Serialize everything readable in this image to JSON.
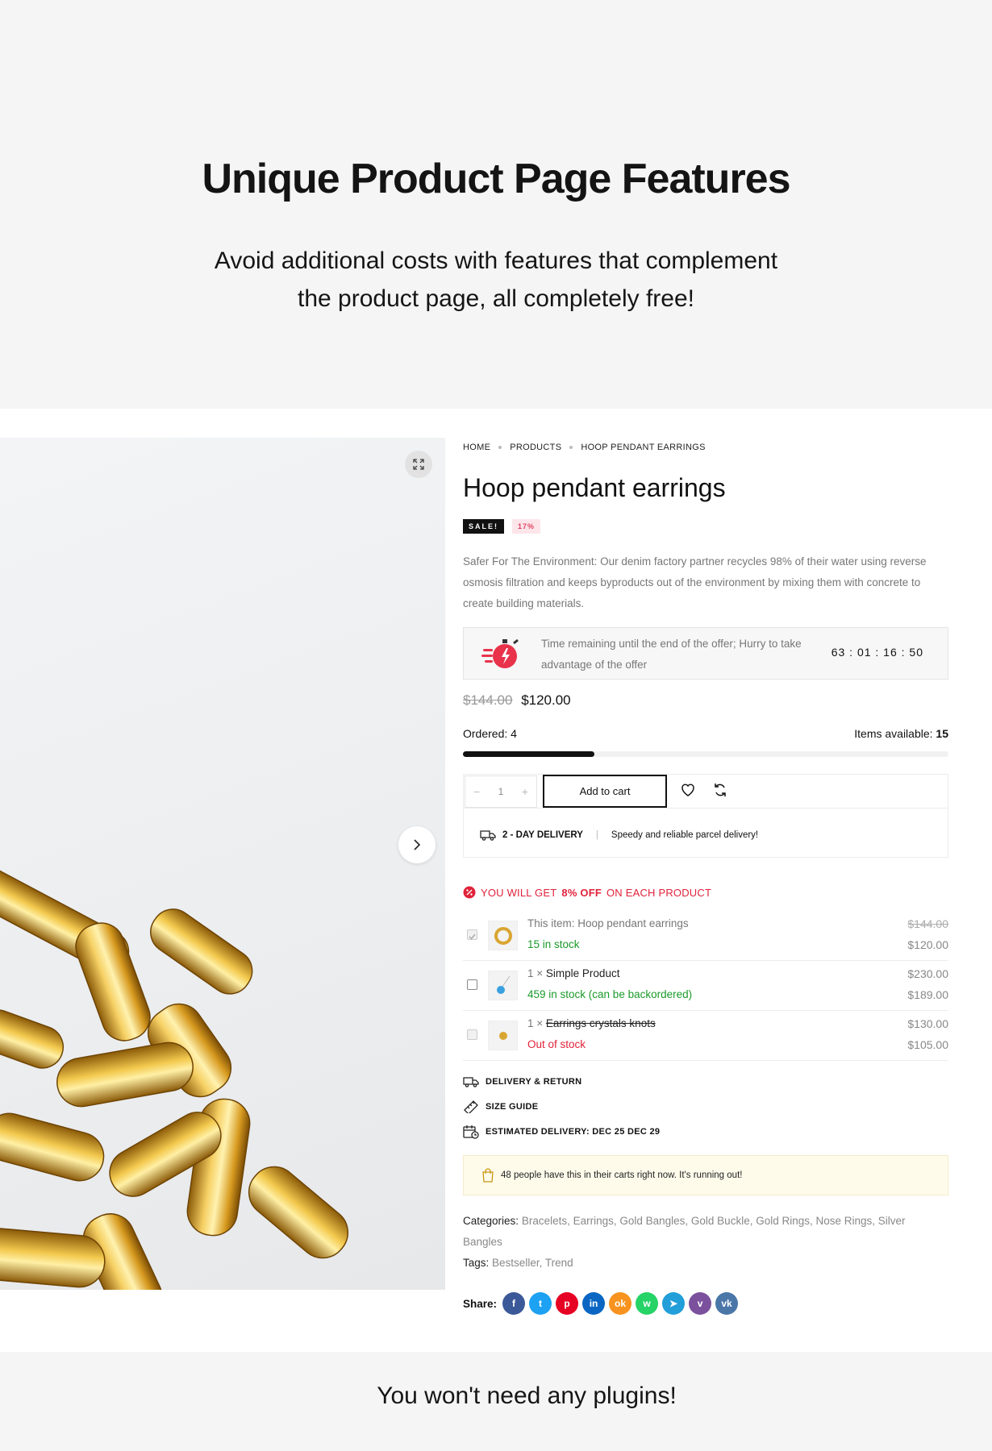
{
  "hero": {
    "title": "Unique Product Page Features",
    "subtitle_line1": "Avoid additional costs with features that complement",
    "subtitle_line2": "the product page, all completely free!"
  },
  "breadcrumb": [
    "HOME",
    "PRODUCTS",
    "HOOP PENDANT EARRINGS"
  ],
  "product": {
    "title": "Hoop pendant earrings",
    "badge_sale": "SALE!",
    "badge_discount": "17%",
    "description": "Safer For The Environment: Our denim factory partner recycles 98% of their water using reverse osmosis filtration and keeps byproducts out of the environment by mixing them with concrete to create building materials.",
    "price_old": "$144.00",
    "price_new": "$120.00"
  },
  "offer": {
    "text": "Time remaining until the end of the offer; Hurry to take advantage of the offer",
    "timer": "63 : 01 : 16 : 50"
  },
  "stock": {
    "ordered_label": "Ordered:",
    "ordered_value": "4",
    "available_label": "Items available:",
    "available_value": "15",
    "sold_fraction": 0.27
  },
  "cart": {
    "qty_minus": "−",
    "qty_value": "1",
    "qty_plus": "+",
    "add_label": "Add to cart"
  },
  "delivery": {
    "label": "2 - DAY DELIVERY",
    "pipe": "|",
    "text": "Speedy and reliable parcel delivery!"
  },
  "bundle": {
    "prefix": "YOU WILL GET",
    "highlight": "8% OFF",
    "suffix": "ON EACH PRODUCT",
    "items": [
      {
        "prefix": "This item: ",
        "name": "Hoop pendant earrings",
        "stock": "15 in stock",
        "price_old": "$144.00",
        "price_new": "$120.00"
      },
      {
        "prefix": "1 × ",
        "name": "Simple Product",
        "stock": "459 in stock (can be backordered)",
        "price_old": "$230.00",
        "price_new": "$189.00"
      },
      {
        "prefix": "1 × ",
        "name": "Earrings crystals knots",
        "stock": "Out of stock",
        "price_old": "$130.00",
        "price_new": "$105.00"
      }
    ]
  },
  "links": {
    "delivery_return": "DELIVERY & RETURN",
    "size_guide": "SIZE GUIDE",
    "estimated": "ESTIMATED DELIVERY: DEC 25 DEC 29"
  },
  "notice": "48 people have this in their carts right now. It's running out!",
  "meta": {
    "categories_label": "Categories:",
    "categories": "Bracelets, Earrings, Gold Bangles, Gold Buckle, Gold Rings, Nose Rings, Silver Bangles",
    "tags_label": "Tags:",
    "tags": "Bestseller, Trend"
  },
  "share": {
    "label": "Share:",
    "networks": [
      {
        "name": "facebook-icon",
        "glyph": "f",
        "color": "#3b5998"
      },
      {
        "name": "twitter-icon",
        "glyph": "t",
        "color": "#1da1f2"
      },
      {
        "name": "pinterest-icon",
        "glyph": "p",
        "color": "#e60023"
      },
      {
        "name": "linkedin-icon",
        "glyph": "in",
        "color": "#0a66c2"
      },
      {
        "name": "odnoklassniki-icon",
        "glyph": "ok",
        "color": "#f7931e"
      },
      {
        "name": "whatsapp-icon",
        "glyph": "w",
        "color": "#25d366"
      },
      {
        "name": "telegram-icon",
        "glyph": "➤",
        "color": "#229ed9"
      },
      {
        "name": "viber-icon",
        "glyph": "v",
        "color": "#7b519d"
      },
      {
        "name": "vk-icon",
        "glyph": "vk",
        "color": "#4a76a8"
      }
    ]
  },
  "footer": {
    "title": "You won't need any plugins!"
  },
  "colors": {
    "accent_red": "#e0223a",
    "stock_green": "#1a9a2a",
    "notice_bg": "#fffbeb"
  }
}
